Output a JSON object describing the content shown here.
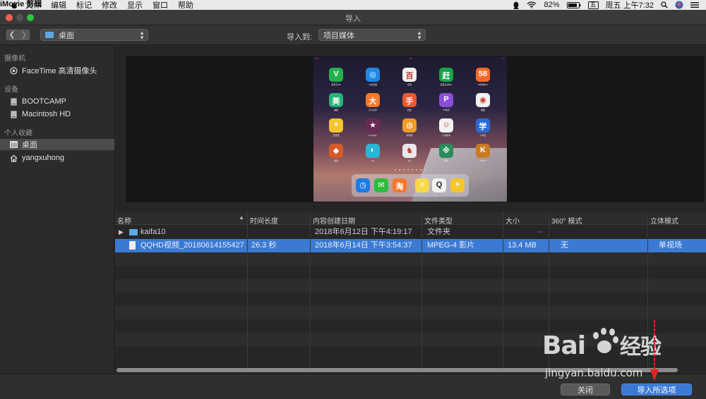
{
  "menubar": {
    "app_name": "iMovie 剪辑",
    "items": [
      "文件",
      "编辑",
      "标记",
      "修改",
      "显示",
      "窗口",
      "帮助"
    ],
    "battery": "82%",
    "input_method": "五",
    "clock": "周五 上午7:32"
  },
  "window": {
    "title": "导入"
  },
  "toolbar": {
    "location": "桌面",
    "import_to_label": "导入到:",
    "destination": "项目媒体"
  },
  "sidebar": {
    "sections": [
      {
        "header": "摄像机",
        "items": [
          {
            "label": "FaceTime 高清摄像头",
            "icon": "camera-icon"
          }
        ]
      },
      {
        "header": "设备",
        "items": [
          {
            "label": "BOOTCAMP",
            "icon": "disk-icon"
          },
          {
            "label": "Macintosh HD",
            "icon": "disk-icon"
          }
        ]
      },
      {
        "header": "个人收藏",
        "items": [
          {
            "label": "桌面",
            "icon": "desktop-icon",
            "selected": true
          },
          {
            "label": "yangxuhong",
            "icon": "home-icon"
          }
        ]
      }
    ]
  },
  "table": {
    "columns": [
      "名称",
      "时间长度",
      "内容创建日期",
      "文件类型",
      "大小",
      "360° 模式",
      "立体模式"
    ],
    "rows": [
      {
        "name": "kaifa10",
        "duration": "",
        "created": "2018年6月12日 下午4:19:17",
        "type": "文件夹",
        "size": "--",
        "mode360": "",
        "stereo": "",
        "kind": "folder",
        "selected": false
      },
      {
        "name": "QQHD视频_20180614155427...",
        "duration": "26.3 秒",
        "created": "2018年6月14日 下午3:54:37",
        "type": "MPEG-4 影片",
        "size": "13.4 MB",
        "mode360": "无",
        "stereo": "单视场",
        "kind": "file",
        "selected": true
      }
    ]
  },
  "footer": {
    "close_label": "关闭",
    "import_label": "导入所选项"
  },
  "preview": {
    "apps": [
      {
        "g": "V",
        "c": "#22b14c",
        "label": "爱奇艺HD"
      },
      {
        "g": "◎",
        "c": "#1e88e5",
        "label": "斗鱼直播"
      },
      {
        "g": "百",
        "c": "#f0f0f0",
        "label": "百度"
      },
      {
        "g": "赶",
        "c": "#1aa34a",
        "label": "赶集生活HD"
      },
      {
        "g": "58",
        "c": "#f36b2a",
        "label": "58同城HD"
      },
      {
        "g": "美",
        "c": "#23b57a",
        "label": "美团"
      },
      {
        "g": "大",
        "c": "#f5792a",
        "label": "大众点评"
      },
      {
        "g": "手",
        "c": "#e8592b",
        "label": "赶集"
      },
      {
        "g": "P",
        "c": "#8a4fd6",
        "label": "PP助手"
      },
      {
        "g": "◉",
        "c": "#f2f2f2",
        "label": "美图"
      },
      {
        "g": "+",
        "c": "#f7c62f",
        "label": "应用宝"
      },
      {
        "g": "★",
        "c": "#6a2a55",
        "label": "Ezmagic"
      },
      {
        "g": "◍",
        "c": "#f19a2a",
        "label": "学而思"
      },
      {
        "g": "☺",
        "c": "#f2f2f2",
        "label": "小学数学"
      },
      {
        "g": "学",
        "c": "#2a6bd6",
        "label": "小学宝"
      },
      {
        "g": "◆",
        "c": "#d65a2a",
        "label": "游戏"
      },
      {
        "g": "◐",
        "c": "#2ab6d6",
        "label": "CC"
      },
      {
        "g": "♞",
        "c": "#e8e8e8",
        "label": "QQ"
      },
      {
        "g": "※",
        "c": "#2a8a5a",
        "label": "游戏"
      },
      {
        "g": "K",
        "c": "#c77a22",
        "label": "Sketch"
      }
    ],
    "dock": [
      {
        "g": "◷",
        "c": "#1e7be0"
      },
      {
        "g": "✉",
        "c": "#2dbd3c"
      },
      {
        "g": "淘",
        "c": "#f5772a"
      },
      {
        "g": "≡",
        "c": "#f7d84a"
      },
      {
        "g": "Q",
        "c": "#f2f2f2"
      },
      {
        "g": "+",
        "c": "#f7c62f"
      }
    ]
  },
  "watermark": {
    "logo": "Bai经验",
    "url": "jingyan.baidu.com"
  }
}
